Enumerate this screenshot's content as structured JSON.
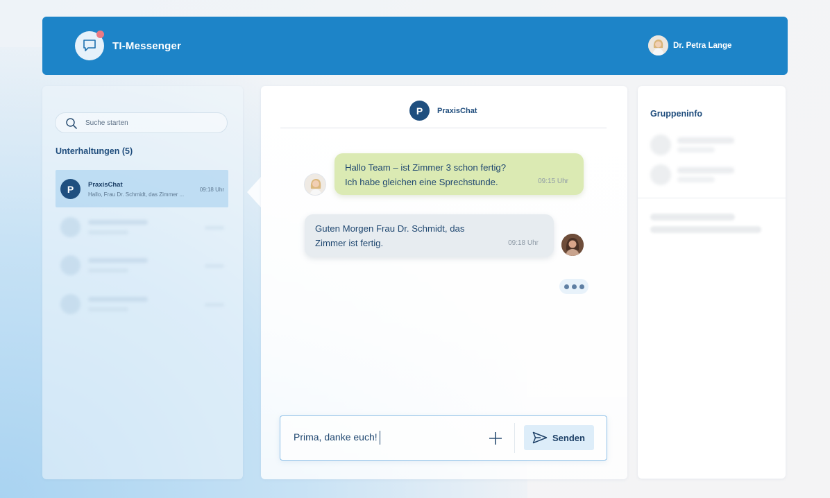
{
  "header": {
    "app_title": "TI-Messenger",
    "user_name": "Dr. Petra Lange"
  },
  "sidebar": {
    "search_placeholder": "Suche starten",
    "heading": "Unterhaltungen (5)",
    "active_conversation": {
      "initial": "P",
      "name": "PraxisChat",
      "preview": "Hallo, Frau Dr. Schmidt, das Zimmer ...",
      "time": "09:18 Uhr"
    }
  },
  "chat": {
    "avatar_initial": "P",
    "name": "PraxisChat",
    "messages": [
      {
        "text_line1": "Hallo Team – ist Zimmer 3 schon fertig?",
        "text_line2": "Ich habe gleichen eine Sprechstunde.",
        "time": "09:15 Uhr"
      },
      {
        "text_line1": "Guten Morgen Frau Dr. Schmidt, das",
        "text_line2": "Zimmer ist fertig.",
        "time": "09:18 Uhr"
      }
    ],
    "composer_value": "Prima, danke euch!",
    "send_label": "Senden"
  },
  "info": {
    "title": "Gruppeninfo"
  },
  "colors": {
    "header": "#1d84c8",
    "incoming_bubble": "#dbeab3",
    "outgoing_bubble": "#e7ecf0",
    "accent_dark": "#1f4f7f",
    "notification_dot": "#ea7a84"
  }
}
